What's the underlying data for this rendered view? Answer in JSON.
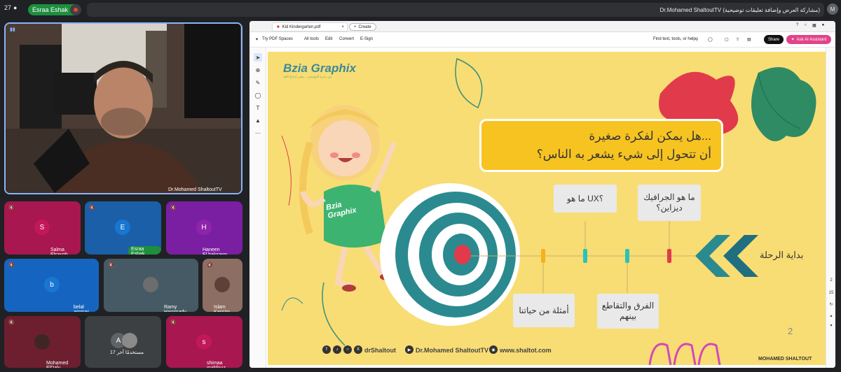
{
  "meeting": {
    "camera_count": "27",
    "active_speaker": "Esraa Eshak",
    "presenting_title": "Dr.Mohamed ShaltoutTV (مشاركة العرض وإضافة تعليقات توضيحية)"
  },
  "main_speaker": {
    "name": "Dr.Mohamed ShaltoutTV"
  },
  "participants": [
    {
      "name": "Salma Elsaygh",
      "initial": "S",
      "color": "#a8174f"
    },
    {
      "name": "Esraa Eshak",
      "initial": "E",
      "color": "#1a5fa8",
      "speaking": true
    },
    {
      "name": "Haneen El.baksawy",
      "initial": "H",
      "color": "#7b1fa2"
    },
    {
      "name": "belal ammar",
      "initial": "b",
      "color": "#1565c0"
    },
    {
      "name": "Ramy Hammady",
      "initial": "",
      "color": "#455a64"
    },
    {
      "name": "Islam Kassim",
      "initial": "",
      "color": "#8d6e63"
    },
    {
      "name": "Mohamed ElDaly",
      "initial": "",
      "color": "#6d1f2f"
    },
    {
      "name": "17 مستخدمًا آخر",
      "initial": "A",
      "color": "#3c4043"
    },
    {
      "name": "shimaa mahfouz",
      "initial": "s",
      "color": "#a8174f"
    }
  ],
  "pdf": {
    "tab_title": "Kid Kindergarten.pdf",
    "create_label": "Create",
    "try_spaces": "Try PDF Spaces",
    "menu": [
      "All tools",
      "Edit",
      "Convert",
      "E-Sign"
    ],
    "find_placeholder": "Find text, tools, or help",
    "share_label": "Share",
    "ai_label": "Ask AI Assistant",
    "page_indicator": [
      "2",
      "15"
    ]
  },
  "slide": {
    "logo": "Bzia Graphix",
    "logo_tagline": "من بذرة البوستر... يبقى إبداع الغد",
    "question_line1": "هل يمكن لفكرة صغيرة...",
    "question_line2": "أن تتحول إلى شيء يشعر به الناس؟",
    "labels_top": [
      "ما هو UX؟",
      "ما هو الجرافيك ديزاين؟"
    ],
    "labels_bottom": [
      "أمثلة من حياتنا",
      "الفرق والتقاطع بينهم"
    ],
    "start_label": "بداية الرحلة",
    "shirt_text": "Bzia Graphix",
    "page_number": "2",
    "footer": {
      "handle": "drShaltout",
      "channel": "Dr.Mohamed ShaltoutTV",
      "website": "www.shaltot.com"
    },
    "brand": "MOHAMED SHALTOUT"
  },
  "colors": {
    "slide_bg": "#f8dd74",
    "accent_yellow": "#f6c321",
    "teal": "#2a8a8f",
    "red": "#e13b4b"
  }
}
